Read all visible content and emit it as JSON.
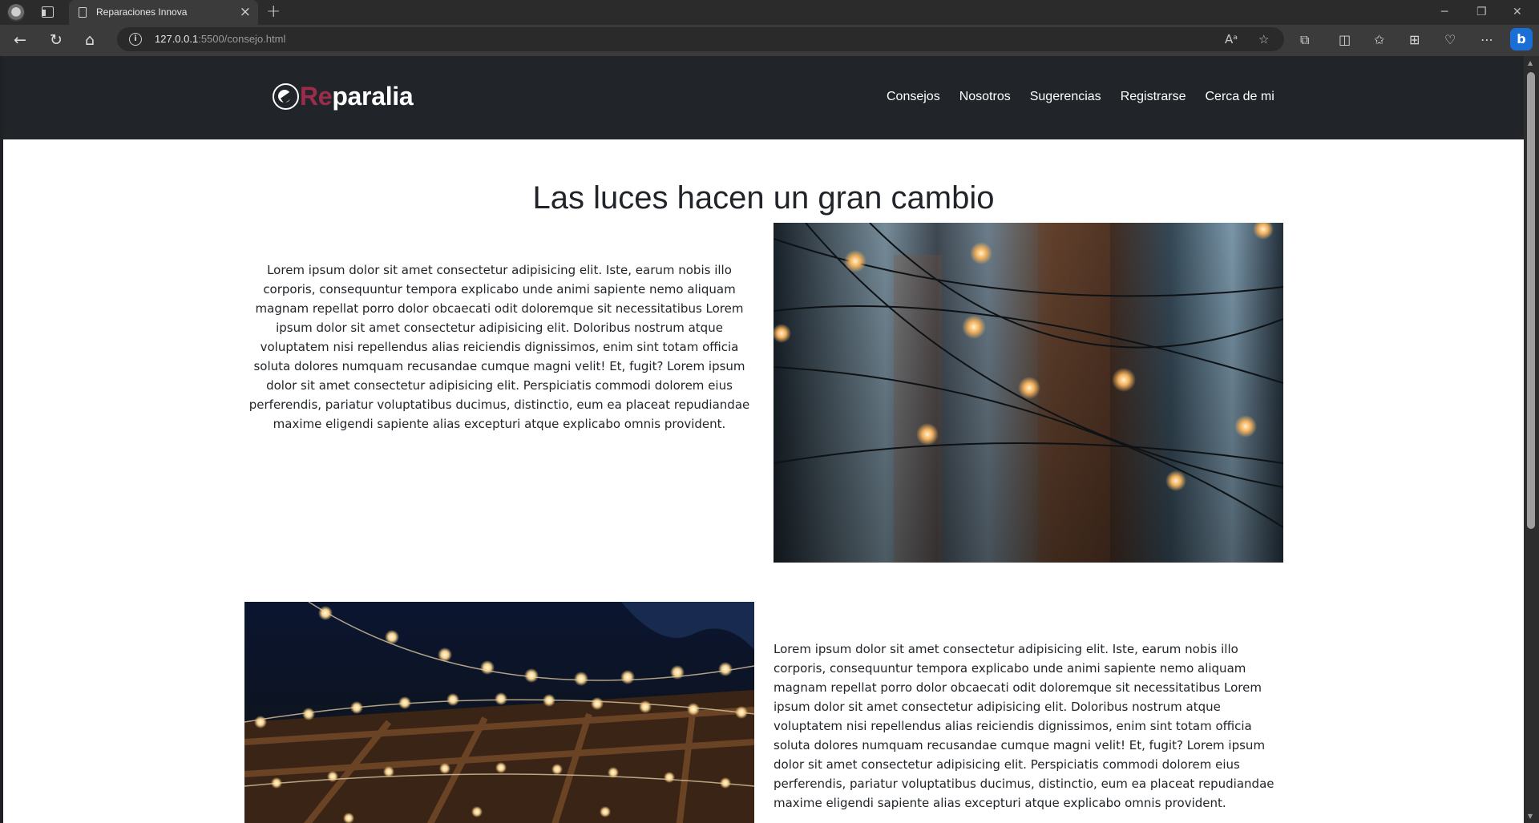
{
  "browser": {
    "tab_title": "Reparaciones Innova",
    "url_host": "127.0.0.1",
    "url_path": ":5500/consejo.html"
  },
  "site": {
    "brand_prefix": "Re",
    "brand_suffix": "paralia",
    "nav": [
      "Consejos",
      "Nosotros",
      "Sugerencias",
      "Registrarse",
      "Cerca de mi"
    ]
  },
  "article": {
    "title": "Las luces hacen un gran cambio",
    "paragraph_1": "Lorem ipsum dolor sit amet consectetur adipisicing elit. Iste, earum nobis illo corporis, consequuntur tempora explicabo unde animi sapiente nemo aliquam magnam repellat porro dolor obcaecati odit doloremque sit necessitatibus Lorem ipsum dolor sit amet consectetur adipisicing elit. Doloribus nostrum atque voluptatem nisi repellendus alias reiciendis dignissimos, enim sint totam officia soluta dolores numquam recusandae cumque magni velit! Et, fugit? Lorem ipsum dolor sit amet consectetur adipisicing elit. Perspiciatis commodi dolorem eius perferendis, pariatur voluptatibus ducimus, distinctio, eum ea placeat repudiandae maxime eligendi sapiente alias excepturi atque explicabo omnis provident.",
    "paragraph_2": "Lorem ipsum dolor sit amet consectetur adipisicing elit. Iste, earum nobis illo corporis, consequuntur tempora explicabo unde animi sapiente nemo aliquam magnam repellat porro dolor obcaecati odit doloremque sit necessitatibus Lorem ipsum dolor sit amet consectetur adipisicing elit. Doloribus nostrum atque voluptatem nisi repellendus alias reiciendis dignissimos, enim sint totam officia soluta dolores numquam recusandae cumque magni velit! Et, fugit? Lorem ipsum dolor sit amet consectetur adipisicing elit. Perspiciatis commodi dolorem eius perferendis, pariatur voluptatibus ducimus, distinctio, eum ea placeat repudiandae maxime eligendi sapiente alias excepturi atque explicabo omnis provident."
  },
  "colors": {
    "navbar_bg": "#212529",
    "brand_accent": "#9b2c4c",
    "text": "#212529"
  },
  "icons": [
    "profile-icon",
    "tab-actions-icon",
    "page-icon",
    "close-icon",
    "new-tab-icon",
    "minimize-icon",
    "restore-icon",
    "window-close-icon",
    "back-icon",
    "refresh-icon",
    "home-icon",
    "info-icon",
    "read-aloud-icon",
    "favorite-icon",
    "extensions-icon",
    "split-screen-icon",
    "favorites-icon",
    "collections-icon",
    "performance-icon",
    "more-icon",
    "bing-icon",
    "brand-logo-icon"
  ]
}
